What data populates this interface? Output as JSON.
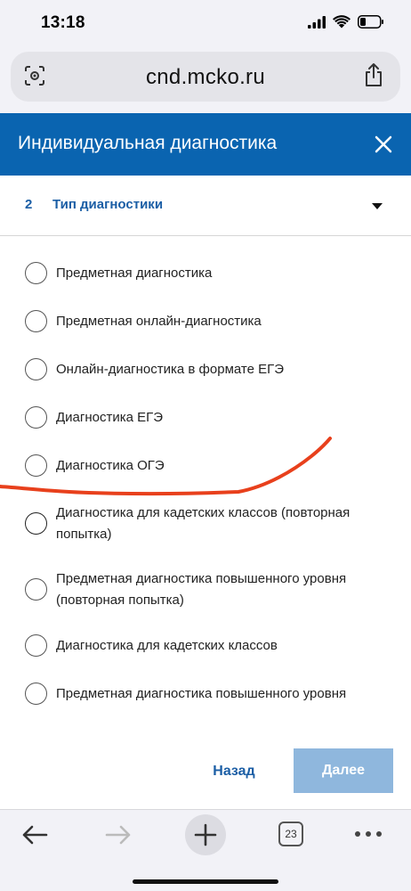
{
  "status_bar": {
    "time": "13:18"
  },
  "browser": {
    "url": "cnd.mcko.ru",
    "tabs_count": "23"
  },
  "modal": {
    "title": "Индивидуальная диагностика",
    "step_number": "2",
    "step_title": "Тип диагностики"
  },
  "options": [
    {
      "label": "Предметная диагностика",
      "selected": false
    },
    {
      "label": "Предметная онлайн-диагностика",
      "selected": false
    },
    {
      "label": "Онлайн-диагностика в формате ЕГЭ",
      "selected": false
    },
    {
      "label": "Диагностика ЕГЭ",
      "selected": false
    },
    {
      "label": "Диагностика ОГЭ",
      "selected": false
    },
    {
      "label": "Диагностика для кадетских классов (повторная попытка)",
      "selected": false
    },
    {
      "label": "Предметная диагностика повышенного уровня (повторная попытка)",
      "selected": false
    },
    {
      "label": "Диагностика для кадетских классов",
      "selected": false
    },
    {
      "label": "Предметная диагностика повышенного уровня",
      "selected": false
    }
  ],
  "footer": {
    "back_label": "Назад",
    "next_label": "Далее"
  },
  "colors": {
    "header_blue": "#0a64b0",
    "link_blue": "#1b5ea5",
    "next_disabled": "#8fb7dd",
    "annotation_red": "#e8401c"
  },
  "icons": {
    "url_left": "screen-capture-icon",
    "url_right": "share-icon",
    "close": "close-icon",
    "back": "back-arrow-icon",
    "forward": "forward-arrow-icon",
    "new_tab": "plus-icon",
    "more": "more-dots-icon"
  }
}
